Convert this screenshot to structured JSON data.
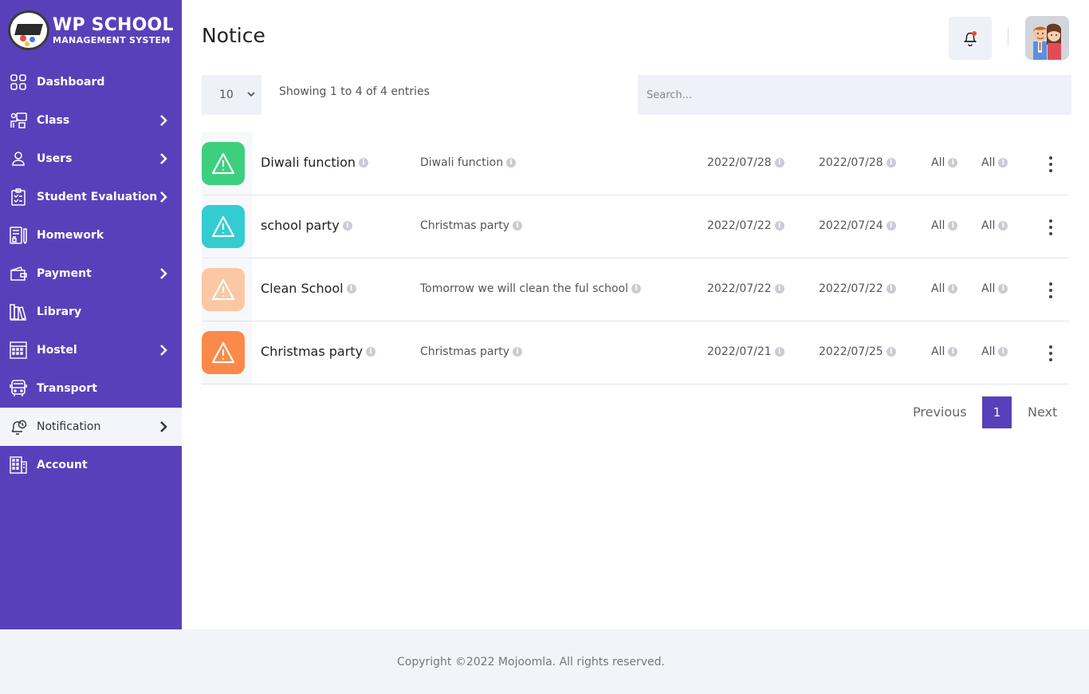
{
  "brand": {
    "title": "WP SCHOOL",
    "subtitle": "MANAGEMENT SYSTEM"
  },
  "sidebar": {
    "items": [
      {
        "label": "Dashboard",
        "icon": "dashboard-grid-icon",
        "has_submenu": false,
        "active": false
      },
      {
        "label": "Class",
        "icon": "class-teacher-icon",
        "has_submenu": true,
        "active": false
      },
      {
        "label": "Users",
        "icon": "user-icon",
        "has_submenu": true,
        "active": false
      },
      {
        "label": "Student Evaluation",
        "icon": "clipboard-icon",
        "has_submenu": true,
        "active": false
      },
      {
        "label": "Homework",
        "icon": "homework-icon",
        "has_submenu": false,
        "active": false
      },
      {
        "label": "Payment",
        "icon": "wallet-icon",
        "has_submenu": true,
        "active": false
      },
      {
        "label": "Library",
        "icon": "books-icon",
        "has_submenu": false,
        "active": false
      },
      {
        "label": "Hostel",
        "icon": "hostel-building-icon",
        "has_submenu": true,
        "active": false
      },
      {
        "label": "Transport",
        "icon": "bus-icon",
        "has_submenu": false,
        "active": false
      },
      {
        "label": "Notification",
        "icon": "bell-clock-icon",
        "has_submenu": true,
        "active": true
      },
      {
        "label": "Account",
        "icon": "account-building-icon",
        "has_submenu": false,
        "active": false
      }
    ]
  },
  "header": {
    "title": "Notice"
  },
  "controls": {
    "page_size": "10",
    "showing": "Showing 1 to 4 of 4 entries",
    "search_placeholder": "Search..."
  },
  "notices": [
    {
      "title": "Diwali function",
      "description": "Diwali function",
      "start": "2022/07/28",
      "end": "2022/07/28",
      "class": "All",
      "section": "All",
      "color": "#3ccf7e"
    },
    {
      "title": "school party",
      "description": "Christmas party",
      "start": "2022/07/22",
      "end": "2022/07/24",
      "class": "All",
      "section": "All",
      "color": "#33ccd1"
    },
    {
      "title": "Clean School",
      "description": "Tomorrow we will clean the ful school",
      "start": "2022/07/22",
      "end": "2022/07/22",
      "class": "All",
      "section": "All",
      "color": "#fcc7a4"
    },
    {
      "title": "Christmas party",
      "description": "Christmas party",
      "start": "2022/07/21",
      "end": "2022/07/25",
      "class": "All",
      "section": "All",
      "color": "#fb8a4a"
    }
  ],
  "pagination": {
    "previous": "Previous",
    "current": "1",
    "next": "Next"
  },
  "footer": {
    "text": "Copyright ©2022 Mojoomla. All rights reserved."
  },
  "colors": {
    "primary": "#5840bb",
    "notification_dot": "#ef4c3b"
  }
}
